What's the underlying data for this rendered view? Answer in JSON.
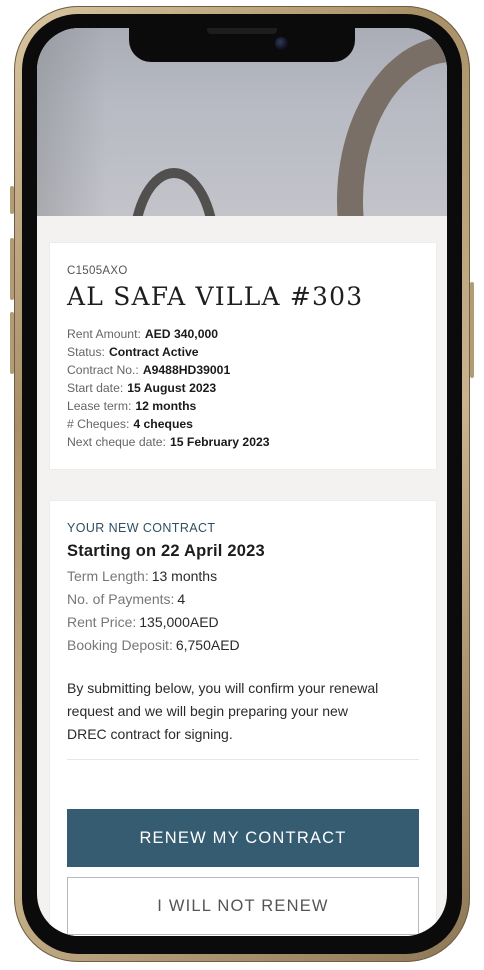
{
  "property": {
    "code": "C1505AXO",
    "name": "AL SAFA VILLA #303",
    "details": [
      {
        "label": "Rent Amount:",
        "value": "AED 340,000"
      },
      {
        "label": "Status:",
        "value": "Contract Active"
      },
      {
        "label": "Contract No.:",
        "value": "A9488HD39001"
      },
      {
        "label": "Start date:",
        "value": "15 August 2023"
      },
      {
        "label": "Lease term:",
        "value": "12 months"
      },
      {
        "label": "# Cheques:",
        "value": "4 cheques"
      },
      {
        "label": "Next cheque date:",
        "value": "15 February 2023"
      }
    ]
  },
  "new_contract": {
    "section_label": "YOUR NEW CONTRACT",
    "start_text": "Starting on 22 April 2023",
    "terms": [
      {
        "label": "Term Length:",
        "value": "13 months"
      },
      {
        "label": "No. of Payments:",
        "value": "4"
      },
      {
        "label": "Rent Price:",
        "value": "135,000AED"
      },
      {
        "label": "Booking Deposit:",
        "value": "6,750AED"
      }
    ],
    "confirmation_text": "By submitting below, you will confirm your renewal request and we will begin preparing your new DREC contract for signing."
  },
  "actions": {
    "renew_label": "RENEW MY CONTRACT",
    "decline_label": "I WILL NOT RENEW"
  },
  "colors": {
    "accent": "#355c71",
    "section_label": "#2f4f62",
    "frame_gold": "#c9b48d"
  }
}
